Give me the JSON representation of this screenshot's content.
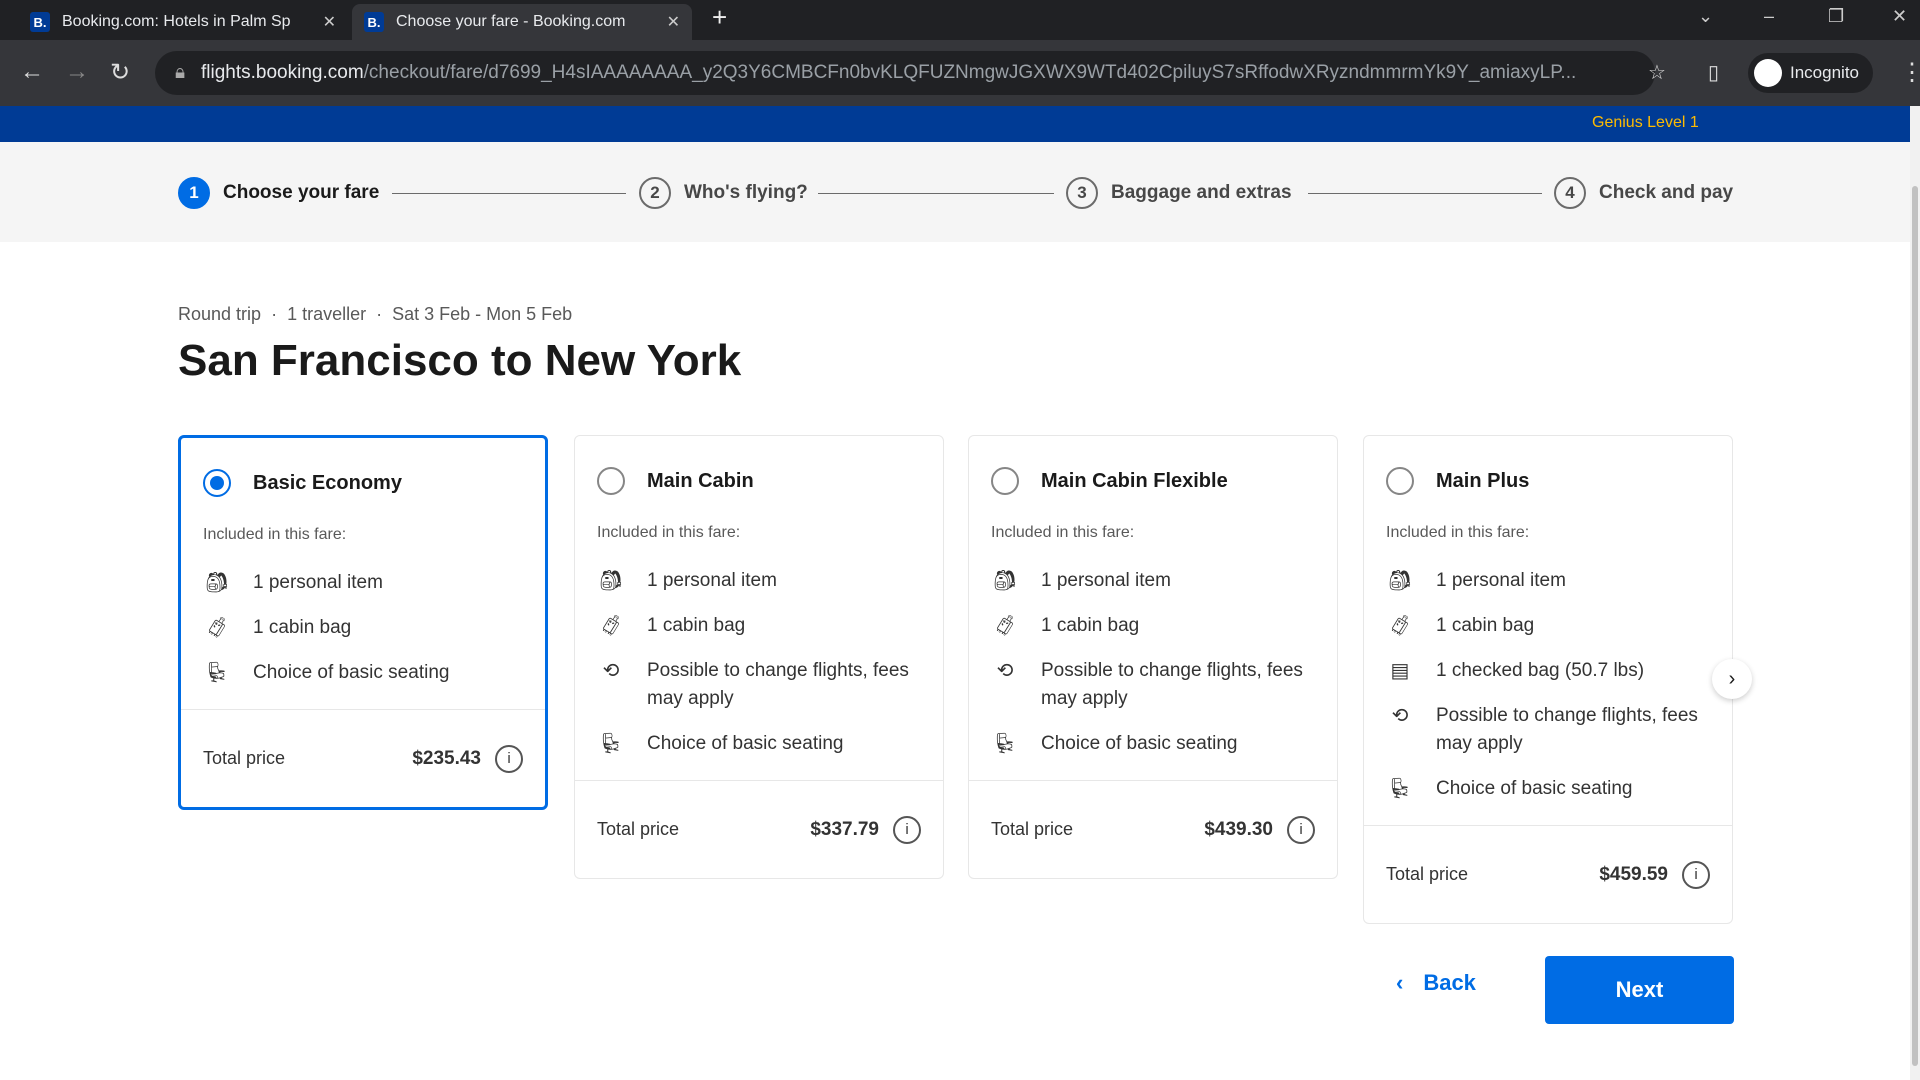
{
  "browser": {
    "tabs": [
      {
        "title": "Booking.com: Hotels in Palm Sp",
        "favicon": "B."
      },
      {
        "title": "Choose your fare - Booking.com",
        "favicon": "B."
      }
    ],
    "url_host": "flights.booking.com",
    "url_path": "/checkout/fare/d7699_H4sIAAAAAAAA_y2Q3Y6CMBCFn0bvKLQFUZNmgwJGXWX9WTd402CpiluyS7sRffodwXRyzndmmrmYk9Y_amiaxyLP...",
    "incognito": "Incognito"
  },
  "header": {
    "genius": "Genius Level 1"
  },
  "steps": [
    {
      "n": "1",
      "label": "Choose your fare"
    },
    {
      "n": "2",
      "label": "Who's flying?"
    },
    {
      "n": "3",
      "label": "Baggage and extras"
    },
    {
      "n": "4",
      "label": "Check and pay"
    }
  ],
  "trip": {
    "type": "Round trip",
    "travellers": "1 traveller",
    "dates": "Sat 3 Feb - Mon 5 Feb",
    "title": "San Francisco to New York"
  },
  "included_label": "Included in this fare:",
  "total_label": "Total price",
  "fares": [
    {
      "name": "Basic Economy",
      "selected": true,
      "price": "$235.43",
      "items": [
        {
          "icon": "backpack-icon",
          "text": "1 personal item"
        },
        {
          "icon": "suitcase-icon",
          "text": "1 cabin bag"
        },
        {
          "icon": "seat-icon",
          "text": "Choice of basic seating"
        }
      ]
    },
    {
      "name": "Main Cabin",
      "selected": false,
      "price": "$337.79",
      "items": [
        {
          "icon": "backpack-icon",
          "text": "1 personal item"
        },
        {
          "icon": "suitcase-icon",
          "text": "1 cabin bag"
        },
        {
          "icon": "change-flight-icon",
          "text": "Possible to change flights, fees may apply"
        },
        {
          "icon": "seat-icon",
          "text": "Choice of basic seating"
        }
      ]
    },
    {
      "name": "Main Cabin Flexible",
      "selected": false,
      "price": "$439.30",
      "items": [
        {
          "icon": "backpack-icon",
          "text": "1 personal item"
        },
        {
          "icon": "suitcase-icon",
          "text": "1 cabin bag"
        },
        {
          "icon": "change-flight-icon",
          "text": "Possible to change flights, fees may apply"
        },
        {
          "icon": "seat-icon",
          "text": "Choice of basic seating"
        }
      ]
    },
    {
      "name": "Main Plus",
      "selected": false,
      "price": "$459.59",
      "items": [
        {
          "icon": "backpack-icon",
          "text": "1 personal item"
        },
        {
          "icon": "suitcase-icon",
          "text": "1 cabin bag"
        },
        {
          "icon": "checked-bag-icon",
          "text": "1 checked bag (50.7 lbs)"
        },
        {
          "icon": "change-flight-icon",
          "text": "Possible to change flights, fees may apply"
        },
        {
          "icon": "seat-icon",
          "text": "Choice of basic seating"
        }
      ]
    }
  ],
  "actions": {
    "back": "Back",
    "next": "Next"
  },
  "colors": {
    "brand": "#003b95",
    "accent": "#006ce4"
  }
}
